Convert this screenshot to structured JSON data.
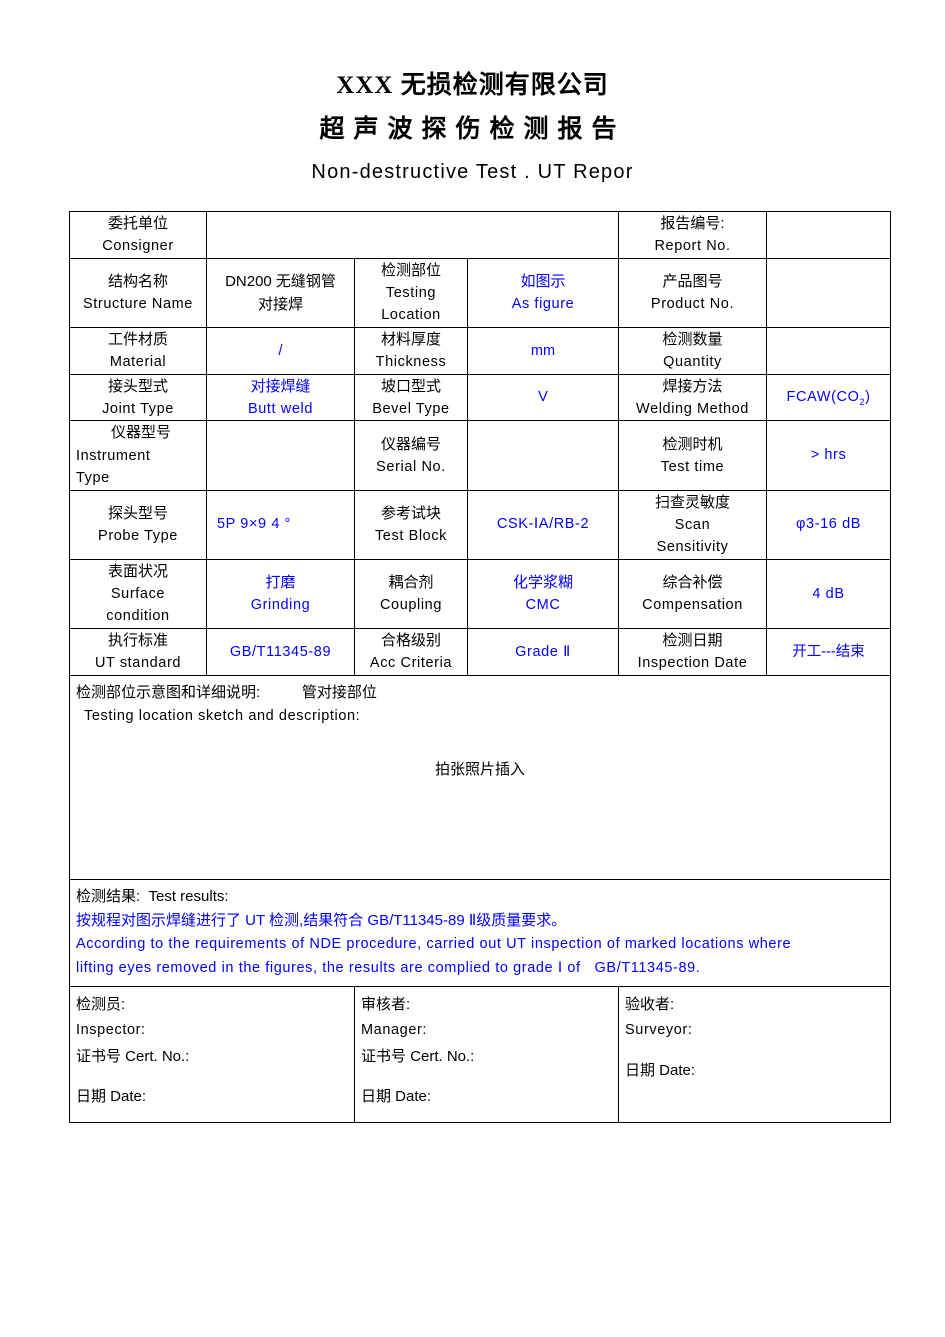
{
  "header": {
    "company": "XXX 无损检测有限公司",
    "title_cn": "超声波探伤检测报告",
    "title_en": "Non-destructive Test . UT Repor"
  },
  "rows": {
    "consigner": {
      "label_cn": "委托单位",
      "label_en": "Consigner",
      "value": "",
      "report_no_cn": "报告编号:",
      "report_no_en": "Report No.",
      "report_no_value": ""
    },
    "structure": {
      "label_cn": "结构名称",
      "label_en": "Structure Name",
      "value_l1": "DN200 无缝钢管",
      "value_l2": "对接焊",
      "mid_cn": "检测部位",
      "mid_en1": "Testing",
      "mid_en2": "Location",
      "mid_value_cn": "如图示",
      "mid_value_en": "As figure",
      "right_cn": "产品图号",
      "right_en": "Product No.",
      "right_value": ""
    },
    "material": {
      "label_cn": "工件材质",
      "label_en": "Material",
      "value": "/",
      "mid_cn": "材料厚度",
      "mid_en": "Thickness",
      "mid_value": "mm",
      "right_cn": "检测数量",
      "right_en": "Quantity",
      "right_value": ""
    },
    "joint": {
      "label_cn": "接头型式",
      "label_en": "Joint Type",
      "value_cn": "对接焊缝",
      "value_en": "Butt weld",
      "mid_cn": "坡口型式",
      "mid_en": "Bevel Type",
      "mid_value": "V",
      "right_cn": "焊接方法",
      "right_en": "Welding Method",
      "right_value": "FCAW(CO2)"
    },
    "instrument": {
      "label_cn": "仪器型号",
      "label_en1": "Instrument",
      "label_en2": "Type",
      "value": "",
      "mid_cn": "仪器编号",
      "mid_en": "Serial No.",
      "mid_value": "",
      "right_cn": "检测时机",
      "right_en": "Test time",
      "right_value": "> hrs"
    },
    "probe": {
      "label_cn": "探头型号",
      "label_en": "Probe Type",
      "value": "5P 9×9 4  °",
      "mid_cn": "参考试块",
      "mid_en": "Test Block",
      "mid_value": "CSK-ⅠA/RB-2",
      "right_cn": "扫查灵敏度",
      "right_en1": "Scan",
      "right_en2": "Sensitivity",
      "right_value": "φ3-16 dB"
    },
    "surface": {
      "label_cn": "表面状况",
      "label_en1": "Surface",
      "label_en2": "condition",
      "value_cn": "打磨",
      "value_en": "Grinding",
      "mid_cn": "耦合剂",
      "mid_en": "Coupling",
      "mid_value_cn": "化学浆糊",
      "mid_value_en": "CMC",
      "right_cn": "综合补偿",
      "right_en": "Compensation",
      "right_value": "4 dB"
    },
    "standard": {
      "label_cn": "执行标准",
      "label_en": "UT standard",
      "value": "GB/T11345-89",
      "mid_cn": "合格级别",
      "mid_en": "Acc Criteria",
      "mid_value": "Grade Ⅱ",
      "right_cn": "检测日期",
      "right_en": "Inspection Date",
      "right_value": "开工---结束"
    }
  },
  "sketch": {
    "line1_cn": "检测部位示意图和详细说明:",
    "line1_note": "管对接部位",
    "line2_en": "Testing location sketch and description:",
    "photo_note": "拍张照片插入"
  },
  "results": {
    "heading": "检测结果:  Test results:",
    "line_cn": "按规程对图示焊缝进行了 UT 检测,结果符合 GB/T11345-89 Ⅱ级质量要求。",
    "line_en1": "According to the requirements of NDE procedure, carried out UT inspection of marked locations where",
    "line_en2": "lifting eyes removed in the figures, the results are complied to grade Ⅰ of   GB/T11345-89."
  },
  "signatures": {
    "inspector": {
      "role_cn": "检测员:",
      "role_en": "Inspector:",
      "cert": "证书号 Cert. No.:",
      "date": "日期 Date:"
    },
    "manager": {
      "role_cn": "审核者:",
      "role_en": "Manager:",
      "cert": "证书号 Cert. No.:",
      "date": "日期 Date:"
    },
    "surveyor": {
      "role_cn": "验收者:",
      "role_en": "Surveyor:",
      "date": "日期 Date:"
    }
  },
  "colors": {
    "fill_text": "#0000ff",
    "static_text": "#000000",
    "border": "#000000"
  }
}
